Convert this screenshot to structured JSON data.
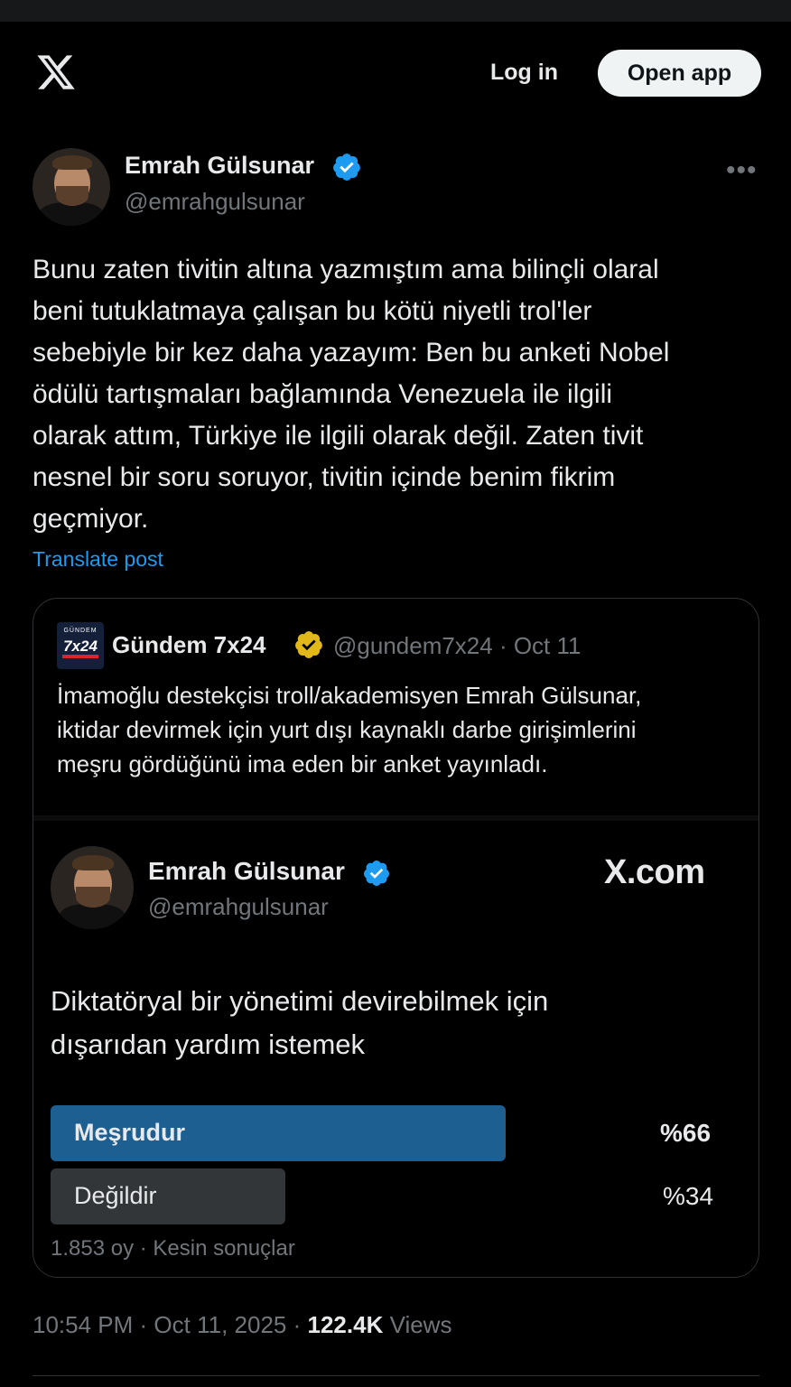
{
  "header": {
    "login_label": "Log in",
    "open_app_label": "Open app",
    "logo_icon": "x-logo-icon"
  },
  "post": {
    "author_name": "Emrah Gülsunar",
    "author_handle": "@emrahgulsunar",
    "verified_color": "#1d9bf0",
    "more_label": "•••",
    "text_lines": [
      "Bunu zaten tivitin altına yazmıştım ama bilinçli olaral",
      "beni tutuklatmaya çalışan bu kötü niyetli trol'ler",
      "sebebiyle bir kez daha yazayım: Ben bu anketi Nobel",
      "ödülü tartışmaları bağlamında Venezuela ile ilgili",
      "olarak attım, Türkiye ile ilgili olarak değil. Zaten tivit",
      "nesnel bir soru soruyor, tivitin içinde benim fikrim",
      "geçmiyor."
    ],
    "translate_label": "Translate post",
    "time": "10:54 PM",
    "date": "Oct 11, 2025",
    "views_count": "122.4K",
    "views_label": "Views"
  },
  "quote": {
    "logo_small": "GÜNDEM",
    "logo_big": "7x24",
    "name": "Gündem 7x24",
    "verified_color": "#e2b719",
    "handle_date": "@gundem7x24 · Oct 11",
    "text_lines": [
      "İmamoğlu destekçisi troll/akademisyen Emrah Gülsunar,",
      "iktidar devirmek için yurt dışı kaynaklı darbe girişimlerini",
      "meşru gördüğünü ima eden bir anket yayınladı."
    ],
    "card": {
      "name": "Emrah Gülsunar",
      "handle": "@emrahgulsunar",
      "brand": "X.com",
      "question_lines": [
        "Diktatöryal bir yönetimi devirebilmek için",
        "dışarıdan yardım istemek"
      ],
      "options": [
        {
          "label": "Meşrudur",
          "percent_label": "%66",
          "share": 0.66,
          "color": "#1d5f91"
        },
        {
          "label": "Değildir",
          "percent_label": "%34",
          "share": 0.34,
          "color": "#333639"
        }
      ],
      "poll_meta": "1.853 oy · Kesin sonuçlar"
    }
  }
}
